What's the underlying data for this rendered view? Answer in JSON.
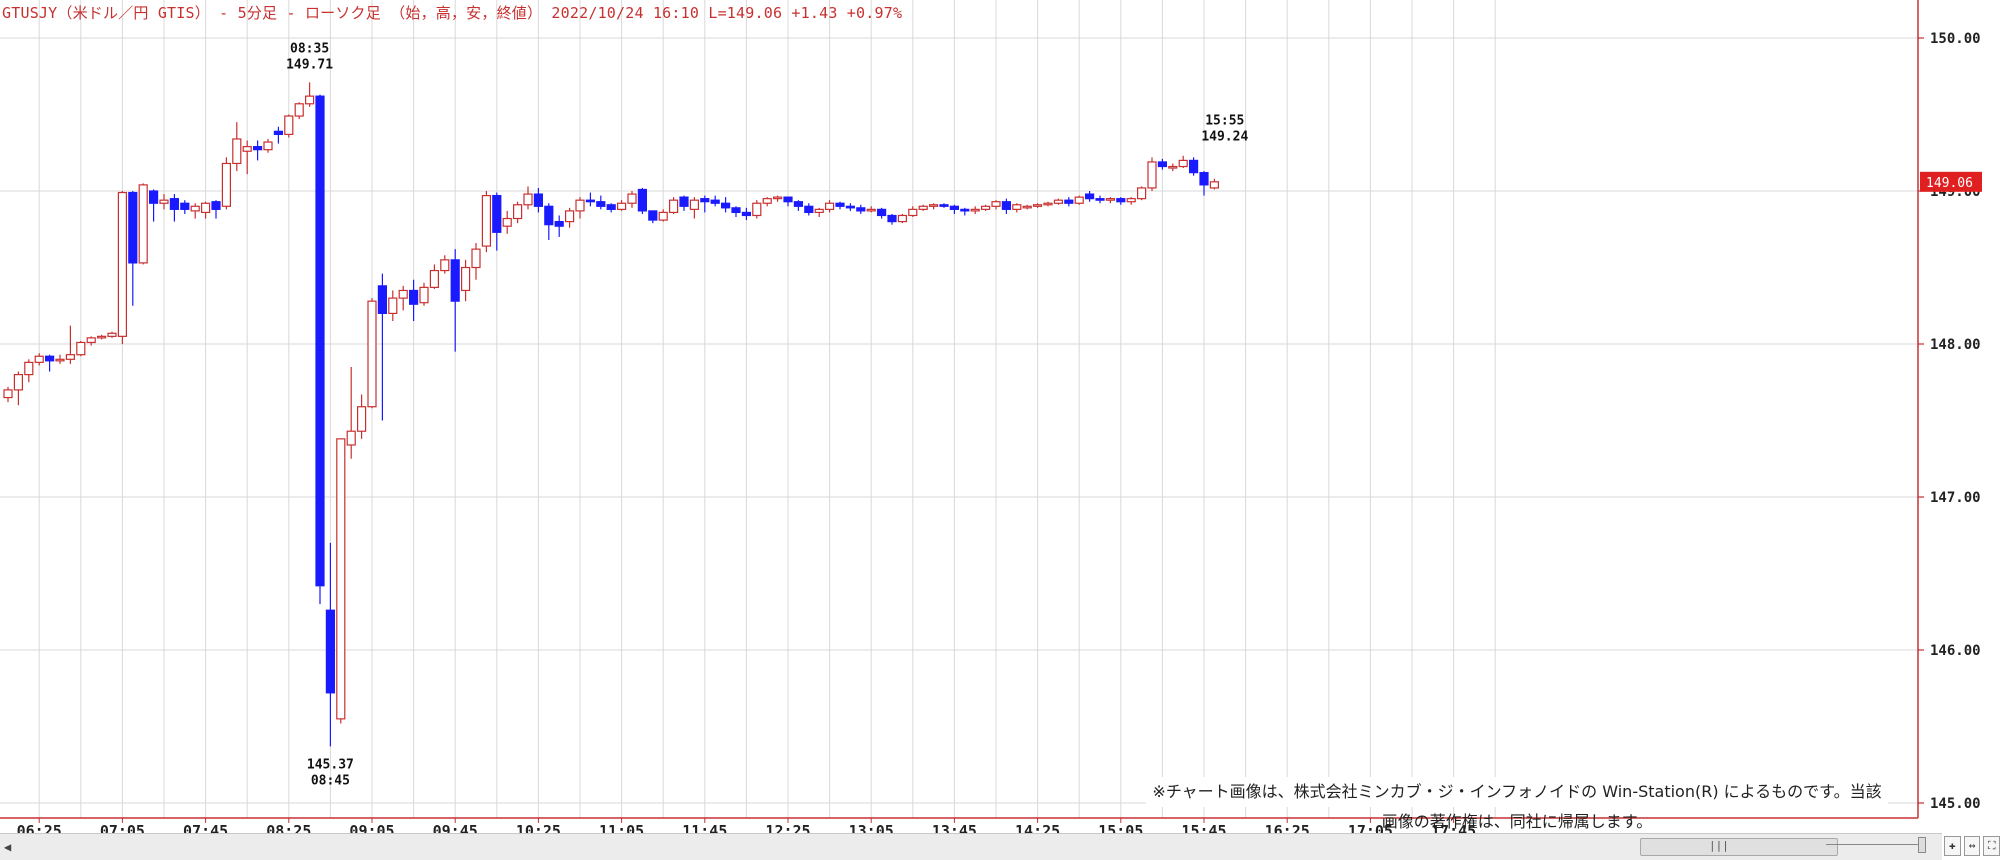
{
  "header": {
    "title": "GTUSJY（米ドル／円 GTIS） - 5分足 - ローソク足 （始，高，安，終値）  2022/10/24 16:10  L=149.06  +1.43  +0.97%"
  },
  "credit": "※チャート画像は、株式会社ミンカブ・ジ・インフォノイドの Win-Station(R) によるものです。当該画像の著作権は、同社に帰属します。",
  "toolbar": {
    "scroll_left": "◀",
    "scroll_grip": "|||",
    "tool_labels": [
      "✚",
      "↔",
      "⛶"
    ]
  },
  "colors": {
    "up": "#c83030",
    "down": "#1a1aff",
    "grid": "#d8d8d8",
    "axis": "#c83030",
    "last_bg": "#e02020"
  },
  "chart_data": {
    "type": "candlestick",
    "interval": "5分足",
    "x_tick_labels": [
      "06:25",
      "07:05",
      "07:45",
      "08:25",
      "09:05",
      "09:45",
      "10:25",
      "11:05",
      "11:45",
      "12:25",
      "13:05",
      "13:45",
      "14:25",
      "15:05",
      "15:45",
      "16:25",
      "17:05",
      "17:45"
    ],
    "y_ticks": [
      "145.00",
      "146.00",
      "147.00",
      "148.00",
      "149.00",
      "150.00"
    ],
    "ylim": [
      144.98,
      150.2
    ],
    "last_price": "149.06",
    "first_time": "06:10",
    "annotations": [
      {
        "time": "08:35",
        "price": "149.71",
        "position": "above"
      },
      {
        "time": "08:45",
        "price": "145.37",
        "position": "below"
      },
      {
        "time": "15:55",
        "price": "149.24",
        "position": "above"
      }
    ],
    "candles": [
      [
        147.65,
        147.72,
        147.62,
        147.7
      ],
      [
        147.7,
        147.82,
        147.6,
        147.8
      ],
      [
        147.8,
        147.9,
        147.75,
        147.88
      ],
      [
        147.88,
        147.94,
        147.86,
        147.92
      ],
      [
        147.92,
        147.93,
        147.82,
        147.89
      ],
      [
        147.89,
        147.93,
        147.87,
        147.9
      ],
      [
        147.9,
        148.12,
        147.87,
        147.93
      ],
      [
        147.93,
        148.02,
        147.92,
        148.01
      ],
      [
        148.01,
        148.05,
        147.99,
        148.04
      ],
      [
        148.04,
        148.06,
        148.03,
        148.05
      ],
      [
        148.05,
        148.08,
        148.04,
        148.07
      ],
      [
        148.05,
        149.0,
        148.0,
        148.99
      ],
      [
        148.99,
        149.0,
        148.25,
        148.53
      ],
      [
        148.53,
        149.05,
        148.52,
        149.04
      ],
      [
        149.0,
        149.01,
        148.8,
        148.92
      ],
      [
        148.92,
        148.98,
        148.88,
        148.94
      ],
      [
        148.95,
        148.98,
        148.8,
        148.88
      ],
      [
        148.92,
        148.94,
        148.85,
        148.88
      ],
      [
        148.87,
        148.92,
        148.82,
        148.9
      ],
      [
        148.86,
        148.93,
        148.82,
        148.92
      ],
      [
        148.93,
        148.94,
        148.82,
        148.88
      ],
      [
        148.9,
        149.22,
        148.88,
        149.18
      ],
      [
        149.18,
        149.45,
        149.13,
        149.34
      ],
      [
        149.26,
        149.33,
        149.11,
        149.29
      ],
      [
        149.29,
        149.33,
        149.2,
        149.27
      ],
      [
        149.27,
        149.34,
        149.25,
        149.32
      ],
      [
        149.39,
        149.42,
        149.31,
        149.37
      ],
      [
        149.37,
        149.5,
        149.35,
        149.49
      ],
      [
        149.49,
        149.58,
        149.47,
        149.57
      ],
      [
        149.57,
        149.71,
        149.55,
        149.62
      ],
      [
        149.62,
        149.63,
        146.3,
        146.42
      ],
      [
        146.26,
        146.7,
        145.37,
        145.72
      ],
      [
        145.55,
        147.38,
        145.52,
        147.38
      ],
      [
        147.34,
        147.85,
        147.25,
        147.43
      ],
      [
        147.43,
        147.67,
        147.38,
        147.59
      ],
      [
        147.59,
        148.3,
        147.58,
        148.28
      ],
      [
        148.38,
        148.46,
        147.5,
        148.2
      ],
      [
        148.2,
        148.35,
        148.15,
        148.3
      ],
      [
        148.3,
        148.38,
        148.22,
        148.35
      ],
      [
        148.35,
        148.42,
        148.15,
        148.26
      ],
      [
        148.27,
        148.4,
        148.25,
        148.37
      ],
      [
        148.37,
        148.52,
        148.36,
        148.48
      ],
      [
        148.48,
        148.58,
        148.46,
        148.55
      ],
      [
        148.55,
        148.62,
        147.95,
        148.28
      ],
      [
        148.35,
        148.55,
        148.28,
        148.5
      ],
      [
        148.5,
        148.66,
        148.42,
        148.62
      ],
      [
        148.64,
        149.0,
        148.6,
        148.97
      ],
      [
        148.97,
        148.99,
        148.61,
        148.73
      ],
      [
        148.77,
        148.87,
        148.72,
        148.82
      ],
      [
        148.82,
        148.93,
        148.79,
        148.91
      ],
      [
        148.91,
        149.03,
        148.88,
        148.98
      ],
      [
        148.98,
        149.02,
        148.86,
        148.9
      ],
      [
        148.9,
        148.92,
        148.68,
        148.78
      ],
      [
        148.8,
        148.84,
        148.7,
        148.77
      ],
      [
        148.8,
        148.89,
        148.76,
        148.87
      ],
      [
        148.87,
        148.96,
        148.82,
        148.94
      ],
      [
        148.94,
        148.99,
        148.9,
        148.93
      ],
      [
        148.93,
        148.97,
        148.88,
        148.9
      ],
      [
        148.91,
        148.92,
        148.86,
        148.88
      ],
      [
        148.88,
        148.94,
        148.87,
        148.92
      ],
      [
        148.92,
        149.0,
        148.89,
        148.98
      ],
      [
        149.01,
        149.02,
        148.85,
        148.87
      ],
      [
        148.87,
        148.87,
        148.79,
        148.81
      ],
      [
        148.81,
        148.88,
        148.8,
        148.86
      ],
      [
        148.86,
        148.96,
        148.85,
        148.94
      ],
      [
        148.96,
        148.97,
        148.87,
        148.9
      ],
      [
        148.88,
        148.96,
        148.82,
        148.94
      ],
      [
        148.95,
        148.97,
        148.86,
        148.93
      ],
      [
        148.94,
        148.97,
        148.9,
        148.92
      ],
      [
        148.92,
        148.96,
        148.86,
        148.89
      ],
      [
        148.89,
        148.9,
        148.83,
        148.86
      ],
      [
        148.86,
        148.89,
        148.81,
        148.84
      ],
      [
        148.84,
        148.94,
        148.82,
        148.92
      ],
      [
        148.92,
        148.96,
        148.9,
        148.95
      ],
      [
        148.95,
        148.97,
        148.93,
        148.96
      ],
      [
        148.96,
        148.96,
        148.9,
        148.93
      ],
      [
        148.93,
        148.94,
        148.87,
        148.9
      ],
      [
        148.9,
        148.92,
        148.84,
        148.86
      ],
      [
        148.86,
        148.89,
        148.83,
        148.88
      ],
      [
        148.88,
        148.94,
        148.86,
        148.92
      ],
      [
        148.92,
        148.93,
        148.88,
        148.9
      ],
      [
        148.9,
        148.92,
        148.87,
        148.89
      ],
      [
        148.89,
        148.91,
        148.85,
        148.87
      ],
      [
        148.87,
        148.9,
        148.86,
        148.88
      ],
      [
        148.88,
        148.89,
        148.82,
        148.84
      ],
      [
        148.84,
        148.85,
        148.78,
        148.8
      ],
      [
        148.8,
        148.85,
        148.79,
        148.84
      ],
      [
        148.84,
        148.9,
        148.83,
        148.88
      ],
      [
        148.88,
        148.91,
        148.87,
        148.9
      ],
      [
        148.9,
        148.92,
        148.88,
        148.91
      ],
      [
        148.91,
        148.92,
        148.89,
        148.9
      ],
      [
        148.9,
        148.91,
        148.85,
        148.88
      ],
      [
        148.88,
        148.89,
        148.84,
        148.87
      ],
      [
        148.87,
        148.9,
        148.85,
        148.88
      ],
      [
        148.88,
        148.91,
        148.87,
        148.9
      ],
      [
        148.9,
        148.94,
        148.88,
        148.93
      ],
      [
        148.93,
        148.95,
        148.85,
        148.88
      ],
      [
        148.88,
        148.92,
        148.86,
        148.91
      ],
      [
        148.89,
        148.91,
        148.88,
        148.9
      ],
      [
        148.9,
        148.92,
        148.89,
        148.91
      ],
      [
        148.91,
        148.93,
        148.9,
        148.92
      ],
      [
        148.92,
        148.95,
        148.91,
        148.94
      ],
      [
        148.94,
        148.96,
        148.9,
        148.92
      ],
      [
        148.92,
        148.97,
        148.91,
        148.96
      ],
      [
        148.98,
        149.0,
        148.93,
        148.95
      ],
      [
        148.95,
        148.97,
        148.92,
        148.94
      ],
      [
        148.94,
        148.96,
        148.92,
        148.95
      ],
      [
        148.95,
        148.96,
        148.91,
        148.93
      ],
      [
        148.93,
        148.96,
        148.91,
        148.95
      ],
      [
        148.95,
        149.03,
        148.94,
        149.02
      ],
      [
        149.02,
        149.22,
        149.0,
        149.19
      ],
      [
        149.19,
        149.21,
        149.14,
        149.16
      ],
      [
        149.16,
        149.18,
        149.13,
        149.16
      ],
      [
        149.16,
        149.23,
        149.15,
        149.2
      ],
      [
        149.2,
        149.22,
        149.1,
        149.12
      ],
      [
        149.12,
        149.13,
        148.97,
        149.04
      ],
      [
        149.02,
        149.08,
        149.01,
        149.06
      ]
    ]
  }
}
